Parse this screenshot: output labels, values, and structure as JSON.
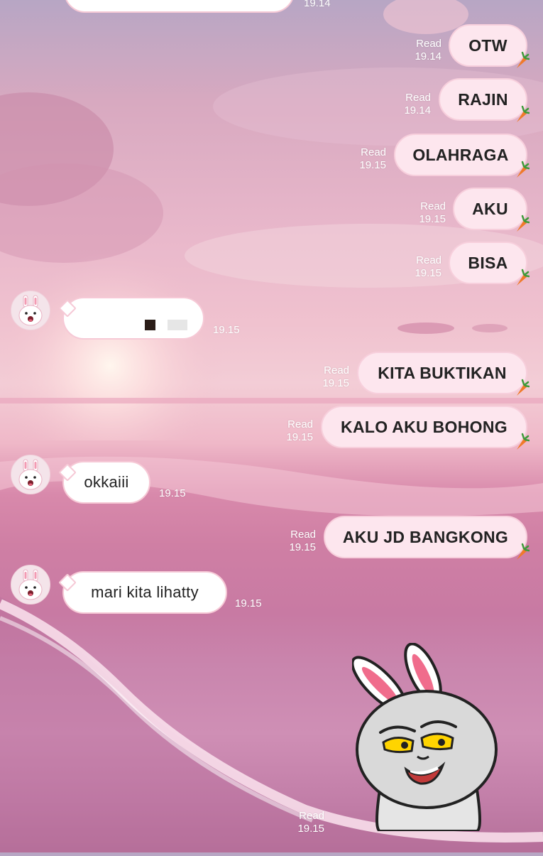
{
  "chat": {
    "top_partial_bubble": {
      "time": "19.14"
    },
    "sent_messages": [
      {
        "text": "OTW",
        "read": "Read",
        "time": "19.14"
      },
      {
        "text": "RAJIN",
        "read": "Read",
        "time": "19.14"
      },
      {
        "text": "OLAHRAGA",
        "read": "Read",
        "time": "19.15"
      },
      {
        "text": "AKU",
        "read": "Read",
        "time": "19.15"
      },
      {
        "text": "BISA",
        "read": "Read",
        "time": "19.15"
      },
      {
        "text": "KITA BUKTIKAN",
        "read": "Read",
        "time": "19.15"
      },
      {
        "text": "KALO AKU BOHONG",
        "read": "Read",
        "time": "19.15"
      },
      {
        "text": "AKU JD BANGKONG",
        "read": "Read",
        "time": "19.15"
      }
    ],
    "received_messages": [
      {
        "text": "",
        "time": "19.15"
      },
      {
        "text": "okkaiii",
        "time": "19.15"
      },
      {
        "text": "mari kita lihatty",
        "time": "19.15"
      }
    ],
    "sticker_message": {
      "read": "Read",
      "time": "19.15",
      "sticker": "smirking-bunny-sticker"
    }
  },
  "theme": {
    "bubble_border": "#f6c9d6",
    "sent_bubble_bg": "#fde6ee",
    "received_bubble_bg": "#ffffff",
    "meta_text": "#ffffff"
  }
}
